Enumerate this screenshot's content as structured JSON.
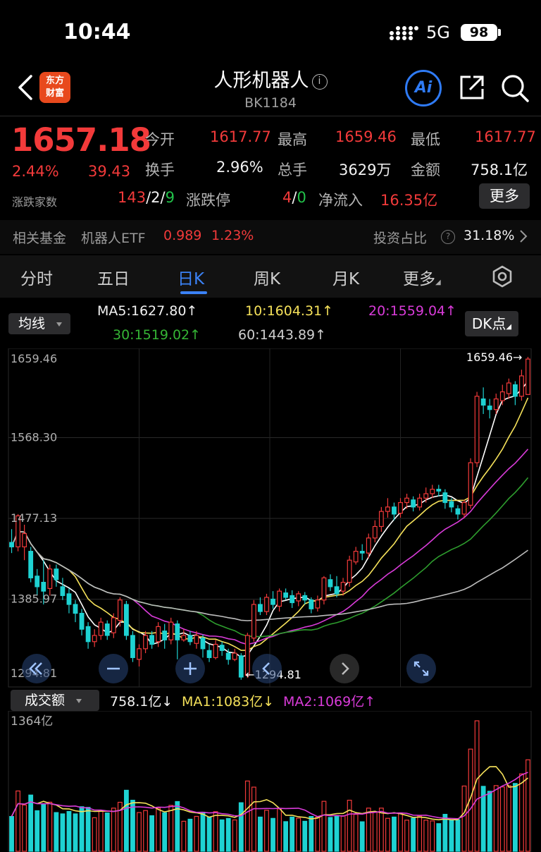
{
  "status_bar": {
    "time": "10:44",
    "network": "5G",
    "battery": "98"
  },
  "header": {
    "title": "人形机器人",
    "code": "BK1184",
    "logo_text_1": "东方",
    "logo_text_2": "财富",
    "ai_label": "Ai"
  },
  "quote": {
    "price": "1657.18",
    "change_pct": "2.44%",
    "change": "39.43",
    "advdec_label": "涨跌家数",
    "open_label": "今开",
    "open": "1617.77",
    "high_label": "最高",
    "high": "1659.46",
    "low_label": "最低",
    "low": "1617.77",
    "turnover_label": "换手",
    "turnover": "2.96%",
    "volume_label": "总手",
    "volume": "3629万",
    "amount_label": "金额",
    "amount": "758.1亿",
    "adv": "143",
    "flat": "2",
    "dec": "9",
    "sep": "/",
    "limit_label": "涨跌停",
    "limit_up": "4",
    "limit_down": "0",
    "inflow_label": "净流入",
    "inflow": "16.35亿",
    "more": "更多"
  },
  "fund": {
    "label": "相关基金",
    "name": "机器人ETF",
    "value": "0.989",
    "pct": "1.23%",
    "ratio_label": "投资占比",
    "ratio": "31.18%"
  },
  "tabs": [
    {
      "label": "分时"
    },
    {
      "label": "五日"
    },
    {
      "label": "日K"
    },
    {
      "label": "周K"
    },
    {
      "label": "月K"
    },
    {
      "label": "更多"
    }
  ],
  "ma": {
    "select": "均线",
    "ma5": "MA5:1627.80↑",
    "ma10": "10:1604.31↑",
    "ma20": "20:1559.04↑",
    "ma30": "30:1519.02↑",
    "ma60": "60:1443.89↑",
    "dk": "DK点"
  },
  "colors": {
    "up": "#f23a3a",
    "down": "#1ed2d2",
    "ma5": "#ffffff",
    "ma10": "#f5e15a",
    "ma20": "#d93bd9",
    "ma30": "#2e9e2e",
    "ma60": "#bdbdbd",
    "accent": "#3b82f6"
  },
  "chart_data": [
    {
      "type": "candlestick",
      "y_axis_labels": [
        "1659.46",
        "1568.30",
        "1477.13",
        "1385.97",
        "1294.81"
      ],
      "ylim": [
        1294.81,
        1659.46
      ],
      "max_annotation": "1659.46→",
      "min_annotation": "←1294.81",
      "candles": [
        [
          1450,
          1445,
          1465,
          1438
        ],
        [
          1445,
          1480,
          1482,
          1440
        ],
        [
          1445,
          1460,
          1470,
          1430
        ],
        [
          1440,
          1410,
          1445,
          1405
        ],
        [
          1412,
          1400,
          1420,
          1390
        ],
        [
          1405,
          1395,
          1430,
          1380
        ],
        [
          1398,
          1420,
          1425,
          1390
        ],
        [
          1420,
          1408,
          1425,
          1400
        ],
        [
          1400,
          1390,
          1410,
          1385
        ],
        [
          1392,
          1380,
          1398,
          1370
        ],
        [
          1380,
          1370,
          1385,
          1360
        ],
        [
          1370,
          1352,
          1375,
          1345
        ],
        [
          1355,
          1338,
          1360,
          1330
        ],
        [
          1338,
          1345,
          1352,
          1332
        ],
        [
          1345,
          1360,
          1365,
          1340
        ],
        [
          1358,
          1345,
          1362,
          1340
        ],
        [
          1348,
          1365,
          1370,
          1342
        ],
        [
          1362,
          1385,
          1388,
          1355
        ],
        [
          1380,
          1345,
          1384,
          1340
        ],
        [
          1345,
          1320,
          1350,
          1315
        ],
        [
          1318,
          1330,
          1335,
          1310
        ],
        [
          1330,
          1345,
          1350,
          1325
        ],
        [
          1345,
          1335,
          1350,
          1330
        ],
        [
          1338,
          1355,
          1360,
          1332
        ],
        [
          1350,
          1340,
          1358,
          1330
        ],
        [
          1340,
          1360,
          1365,
          1335
        ],
        [
          1358,
          1340,
          1362,
          1318
        ],
        [
          1340,
          1345,
          1352,
          1338
        ],
        [
          1345,
          1338,
          1350,
          1334
        ],
        [
          1336,
          1345,
          1350,
          1330
        ],
        [
          1342,
          1330,
          1346,
          1320
        ],
        [
          1328,
          1320,
          1335,
          1315
        ],
        [
          1320,
          1335,
          1340,
          1318
        ],
        [
          1334,
          1328,
          1338,
          1322
        ],
        [
          1325,
          1318,
          1330,
          1312
        ],
        [
          1318,
          1325,
          1330,
          1316
        ],
        [
          1322,
          1298,
          1325,
          1295
        ],
        [
          1300,
          1345,
          1348,
          1297
        ],
        [
          1342,
          1380,
          1385,
          1338
        ],
        [
          1380,
          1372,
          1388,
          1368
        ],
        [
          1372,
          1388,
          1392,
          1368
        ],
        [
          1386,
          1380,
          1395,
          1375
        ],
        [
          1378,
          1395,
          1398,
          1372
        ],
        [
          1393,
          1388,
          1398,
          1385
        ],
        [
          1390,
          1382,
          1396,
          1376
        ],
        [
          1384,
          1392,
          1395,
          1378
        ],
        [
          1390,
          1385,
          1394,
          1380
        ],
        [
          1385,
          1375,
          1388,
          1370
        ],
        [
          1376,
          1385,
          1390,
          1372
        ],
        [
          1385,
          1410,
          1412,
          1380
        ],
        [
          1408,
          1400,
          1414,
          1395
        ],
        [
          1400,
          1392,
          1412,
          1388
        ],
        [
          1395,
          1405,
          1410,
          1390
        ],
        [
          1405,
          1430,
          1435,
          1400
        ],
        [
          1428,
          1440,
          1445,
          1425
        ],
        [
          1440,
          1438,
          1448,
          1430
        ],
        [
          1438,
          1455,
          1460,
          1432
        ],
        [
          1455,
          1468,
          1475,
          1450
        ],
        [
          1468,
          1485,
          1490,
          1462
        ],
        [
          1485,
          1490,
          1500,
          1478
        ],
        [
          1490,
          1482,
          1495,
          1475
        ],
        [
          1483,
          1495,
          1500,
          1478
        ],
        [
          1495,
          1500,
          1505,
          1488
        ],
        [
          1498,
          1490,
          1502,
          1485
        ],
        [
          1490,
          1500,
          1505,
          1486
        ],
        [
          1500,
          1505,
          1512,
          1495
        ],
        [
          1505,
          1510,
          1515,
          1500
        ],
        [
          1510,
          1508,
          1515,
          1502
        ],
        [
          1506,
          1495,
          1510,
          1488
        ],
        [
          1496,
          1490,
          1500,
          1484
        ],
        [
          1488,
          1482,
          1492,
          1476
        ],
        [
          1482,
          1495,
          1498,
          1478
        ],
        [
          1492,
          1540,
          1545,
          1488
        ],
        [
          1540,
          1615,
          1620,
          1535
        ],
        [
          1612,
          1605,
          1625,
          1595
        ],
        [
          1604,
          1600,
          1612,
          1590
        ],
        [
          1600,
          1612,
          1618,
          1595
        ],
        [
          1610,
          1620,
          1628,
          1605
        ],
        [
          1618,
          1630,
          1635,
          1612
        ],
        [
          1628,
          1615,
          1632,
          1605
        ],
        [
          1615,
          1638,
          1645,
          1610
        ],
        [
          1617,
          1657,
          1659.46,
          1617
        ]
      ]
    },
    {
      "type": "bar",
      "title": "成交额",
      "y_axis_label": "1364亿",
      "current": "758.1亿↓",
      "ma1": "MA1:1083亿↓",
      "ma2": "MA2:1069亿↑"
    }
  ]
}
